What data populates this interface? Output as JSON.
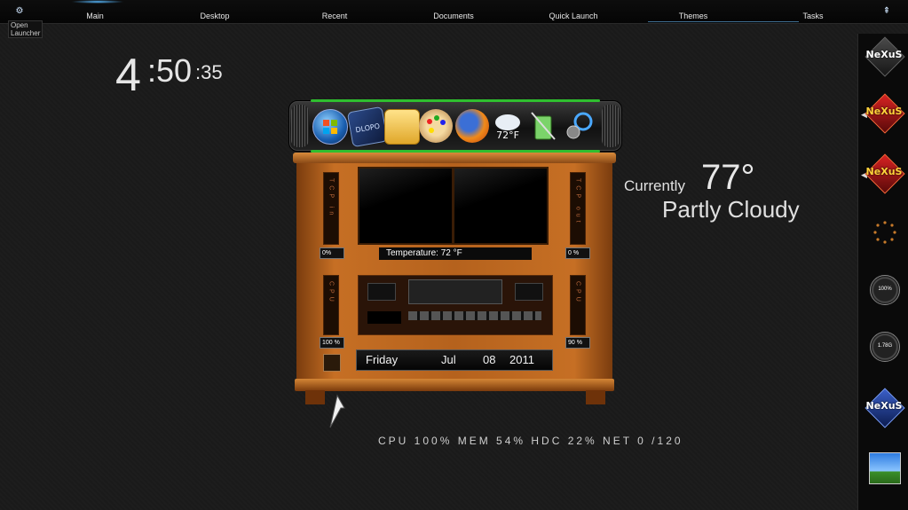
{
  "topbar": {
    "nav": [
      "Main",
      "Desktop",
      "Recent",
      "Documents",
      "Quick Launch",
      "Themes",
      "Tasks"
    ],
    "open_launcher": "Open\nLauncher"
  },
  "clock": {
    "hours": "4",
    "minutes": ":50",
    "seconds": ":35"
  },
  "dock": {
    "icons": [
      "windows-start-icon",
      "dlopo-icon",
      "folder-icon",
      "paint-palette-icon",
      "firefox-icon",
      "weather-icon",
      "recycle-bin-icon",
      "tools-icon"
    ],
    "weather_icon_text": "72°F"
  },
  "cabinet": {
    "tcp_in_label": "TCP in",
    "tcp_out_label": "TCP out",
    "tcp_in_value": "0%",
    "tcp_out_value": "0 %",
    "cpu_left_label": "CPU",
    "cpu_right_label": "CPU",
    "cpu_left_value": "100 %",
    "cpu_right_value": "90 %",
    "temperature": "Temperature: 72 °F",
    "date": {
      "day": "Friday",
      "month": "Jul",
      "date": "08",
      "year": "2011"
    }
  },
  "weather": {
    "currently": "Currently",
    "temp": "77°",
    "condition": "Partly Cloudy"
  },
  "stats": {
    "text": "CPU 100% MEM 54% HDC 22% NET 0 /120"
  },
  "sidebar": {
    "items": [
      {
        "type": "nexus",
        "text": "NeXuS",
        "color": "gray"
      },
      {
        "type": "nexus",
        "text": "NeXuS",
        "color": "red"
      },
      {
        "type": "nexus",
        "text": "NeXuS",
        "color": "red"
      },
      {
        "type": "dots"
      },
      {
        "type": "gauge",
        "text": "100%"
      },
      {
        "type": "gauge",
        "text": "1.78G"
      },
      {
        "type": "nexus",
        "text": "NeXuS",
        "color": "blue"
      },
      {
        "type": "photo"
      }
    ]
  },
  "colors": {
    "accent_green": "#2fbf2f",
    "wood": "#b5621d",
    "background": "#1a1a1a"
  }
}
